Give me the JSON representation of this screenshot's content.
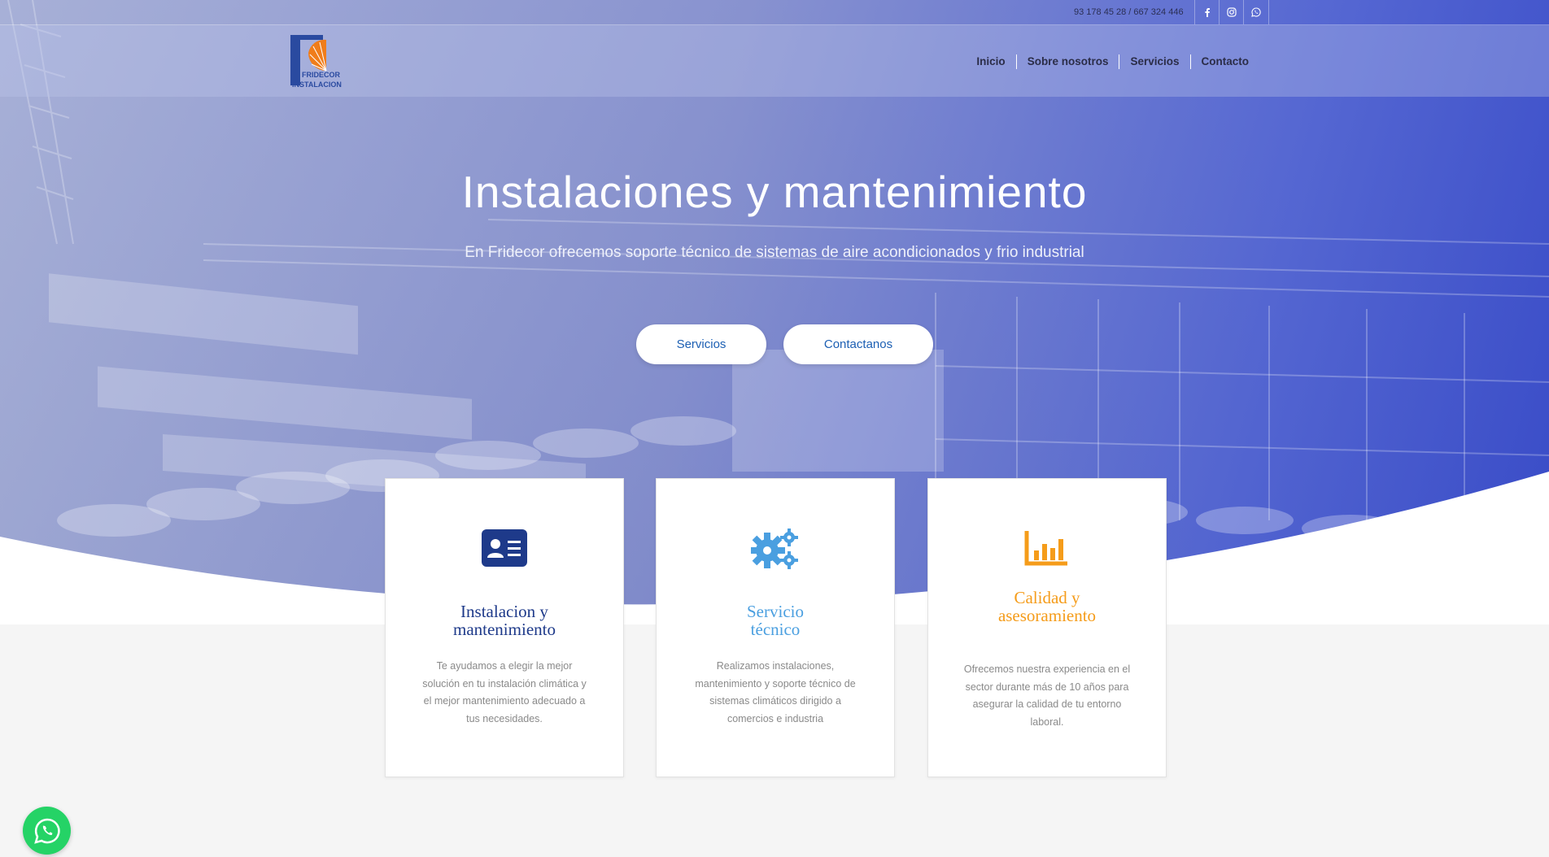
{
  "topbar": {
    "phone": "93 178 45 28 / 667 324 446",
    "social": [
      {
        "name": "facebook-icon"
      },
      {
        "name": "instagram-icon"
      },
      {
        "name": "whatsapp-icon"
      }
    ]
  },
  "header": {
    "logo_text_1": "FRIDECOR",
    "logo_text_2": "INSTALACION",
    "nav": [
      "Inicio",
      "Sobre nosotros",
      "Servicios",
      "Contacto"
    ]
  },
  "hero": {
    "title": "Instalaciones y mantenimiento",
    "subtitle": "En Fridecor ofrecemos soporte técnico de sistemas de aire acondicionados y frio industrial",
    "buttons": [
      "Servicios",
      "Contactanos"
    ]
  },
  "cards": [
    {
      "icon": "id-card-icon",
      "title_1": "Instalacion y",
      "title_2": "mantenimiento",
      "color": "#1e3a8a",
      "text": [
        "Te ayudamos a elegir la mejor",
        "solución en tu instalación climática y",
        "el mejor mantenimiento adecuado a",
        "tus necesidades."
      ]
    },
    {
      "icon": "gears-icon",
      "title_1": "Servicio",
      "title_2": "técnico",
      "color": "#4a9fe0",
      "text": [
        "Realizamos instalaciones,",
        "mantenimiento y soporte técnico de",
        "sistemas climáticos dirigido a",
        "comercios e industria"
      ]
    },
    {
      "icon": "bar-chart-icon",
      "title_1": "Calidad y",
      "title_2": "asesoramiento",
      "color": "#f59c1a",
      "text": [
        "Ofrecemos nuestra experiencia en el",
        "sector durante más de 10 años para",
        "asegurar la calidad de tu entorno",
        "laboral."
      ]
    }
  ],
  "floating": {
    "icon": "whatsapp-icon"
  }
}
